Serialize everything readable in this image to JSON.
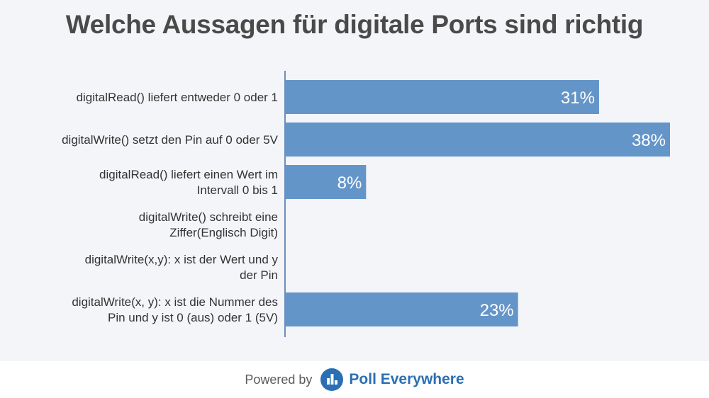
{
  "chart_data": {
    "type": "bar",
    "orientation": "horizontal",
    "title": "Welche Aussagen für digitale Ports sind richtig",
    "categories": [
      [
        "digitalRead() liefert entweder 0 oder 1"
      ],
      [
        "digitalWrite() setzt den Pin auf 0 oder 5V"
      ],
      [
        "digitalRead() liefert einen Wert im",
        "Intervall 0 bis 1"
      ],
      [
        "digitalWrite() schreibt eine",
        "Ziffer(Englisch Digit)"
      ],
      [
        "digitalWrite(x,y): x ist der Wert und y",
        "der Pin"
      ],
      [
        "digitalWrite(x, y): x ist die Nummer des",
        "Pin und y ist 0 (aus) oder 1 (5V)"
      ]
    ],
    "values": [
      31,
      38,
      8,
      0,
      0,
      23
    ],
    "value_labels": [
      "31%",
      "38%",
      "8%",
      "",
      "",
      "23%"
    ],
    "xlim": [
      0,
      38
    ],
    "grid": false,
    "colors": {
      "bar": "#6495c8",
      "axis": "#6b8fbf",
      "label_text": "#ffffff",
      "category_text": "#333333"
    }
  },
  "footer": {
    "powered_by": "Powered by",
    "brand": "Poll Everywhere",
    "logo_icon": "poll-everywhere-logo-icon",
    "brand_color": "#2a6fb3"
  }
}
